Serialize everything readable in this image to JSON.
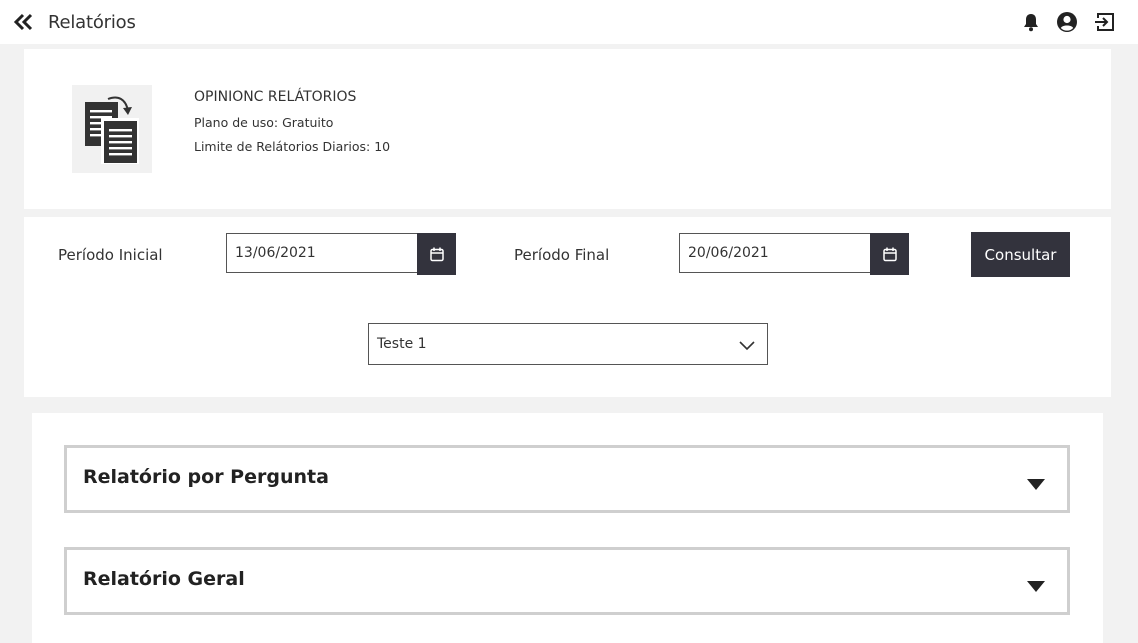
{
  "header": {
    "title": "Relatórios",
    "icons": [
      "double-chevron-left-icon",
      "bell-icon",
      "user-circle-icon",
      "logout-icon"
    ]
  },
  "app_info": {
    "name": "OPINIONC RELÁTORIOS",
    "plan": "Plano de uso: Gratuito",
    "limit": "Limite de Relátorios Diarios: 10",
    "logo_icon": "documents-copy-icon"
  },
  "filters": {
    "start_label": "Período Inicial",
    "start_value": "13/06/2021",
    "end_label": "Período Final",
    "end_value": "20/06/2021",
    "submit_label": "Consultar",
    "survey_selected": "Teste 1"
  },
  "reports": [
    {
      "title": "Relatório por Pergunta"
    },
    {
      "title": "Relatório Geral"
    }
  ],
  "colors": {
    "background": "#f2f2f2",
    "surface": "#ffffff",
    "button_dark": "#33333d",
    "text": "#333333",
    "accordion_border": "#cfcfcf"
  }
}
